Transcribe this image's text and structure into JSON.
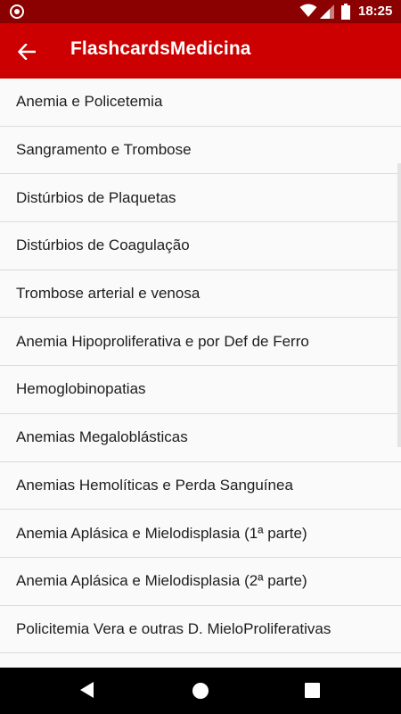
{
  "status_bar": {
    "time": "18:25",
    "icons": [
      "record-icon",
      "wifi-icon",
      "signal-icon",
      "battery-icon"
    ]
  },
  "app_bar": {
    "title": "FlashcardsMedicina",
    "back_icon": "arrow-left-icon"
  },
  "topics": [
    "Anemia e Policetemia",
    "Sangramento e Trombose",
    "Distúrbios de Plaquetas",
    "Distúrbios de Coagulação",
    "Trombose arterial e venosa",
    "Anemia Hipoproliferativa e por Def de Ferro",
    "Hemoglobinopatias",
    "Anemias Megaloblásticas",
    "Anemias Hemolíticas e Perda Sanguínea",
    "Anemia Aplásica e Mielodisplasia (1ª parte)",
    "Anemia Aplásica e Mielodisplasia (2ª parte)",
    "Policitemia Vera e outras D. MieloProliferativas"
  ],
  "navigation_bar": {
    "buttons": [
      "back-triangle-icon",
      "home-circle-icon",
      "recents-square-icon"
    ]
  },
  "colors": {
    "status_bar": "#8b0000",
    "app_bar": "#cc0000",
    "background": "#fafafa",
    "text": "#1e1e1e",
    "divider": "#dcdcdc"
  }
}
